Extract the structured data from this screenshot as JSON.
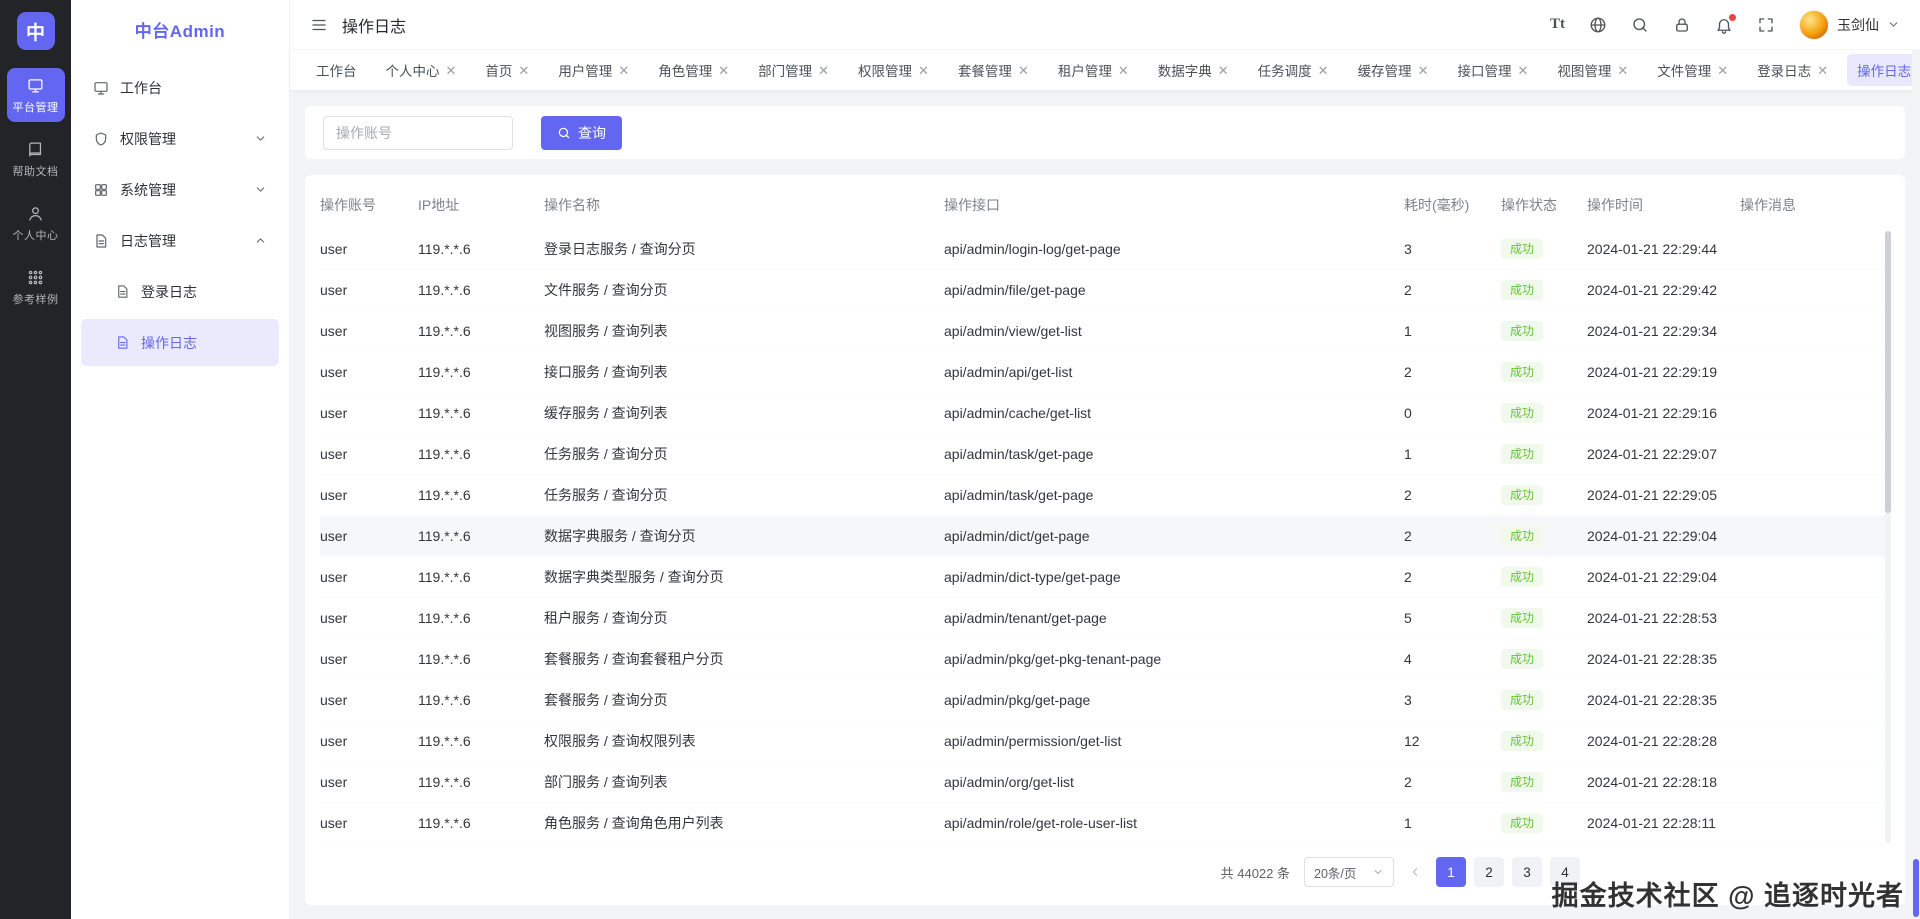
{
  "brand": {
    "logo_text": "中",
    "app_name": "中台Admin"
  },
  "colors": {
    "accent": "#6366f1",
    "success_text": "#67c23a",
    "success_bg": "#f0f9eb",
    "rail_bg": "#232428"
  },
  "rail": {
    "items": [
      {
        "label": "平台管理",
        "icon": "platform",
        "glyph": "monitor",
        "active": true
      },
      {
        "label": "帮助文档",
        "icon": "help-docs",
        "glyph": "book",
        "active": false
      },
      {
        "label": "个人中心",
        "icon": "profile",
        "glyph": "user",
        "active": false
      },
      {
        "label": "参考样例",
        "icon": "samples",
        "glyph": "apps",
        "active": false
      }
    ]
  },
  "sidebar": {
    "title": "中台Admin",
    "items": [
      {
        "label": "工作台",
        "glyph": "monitor",
        "expandable": false
      },
      {
        "label": "权限管理",
        "glyph": "shield",
        "expandable": true,
        "expanded": false
      },
      {
        "label": "系统管理",
        "glyph": "grid",
        "expandable": true,
        "expanded": false
      },
      {
        "label": "日志管理",
        "glyph": "doc",
        "expandable": true,
        "expanded": true,
        "children": [
          {
            "label": "登录日志",
            "active": false
          },
          {
            "label": "操作日志",
            "active": true
          }
        ]
      }
    ]
  },
  "header": {
    "title": "操作日志",
    "user_name": "玉剑仙",
    "actions": [
      "text-size",
      "globe",
      "search",
      "lock",
      "bell",
      "fullscreen"
    ]
  },
  "tabs": [
    {
      "label": "工作台",
      "closable": false,
      "active": false
    },
    {
      "label": "个人中心",
      "closable": true,
      "active": false
    },
    {
      "label": "首页",
      "closable": true,
      "active": false
    },
    {
      "label": "用户管理",
      "closable": true,
      "active": false
    },
    {
      "label": "角色管理",
      "closable": true,
      "active": false
    },
    {
      "label": "部门管理",
      "closable": true,
      "active": false
    },
    {
      "label": "权限管理",
      "closable": true,
      "active": false
    },
    {
      "label": "套餐管理",
      "closable": true,
      "active": false
    },
    {
      "label": "租户管理",
      "closable": true,
      "active": false
    },
    {
      "label": "数据字典",
      "closable": true,
      "active": false
    },
    {
      "label": "任务调度",
      "closable": true,
      "active": false
    },
    {
      "label": "缓存管理",
      "closable": true,
      "active": false
    },
    {
      "label": "接口管理",
      "closable": true,
      "active": false
    },
    {
      "label": "视图管理",
      "closable": true,
      "active": false
    },
    {
      "label": "文件管理",
      "closable": true,
      "active": false
    },
    {
      "label": "登录日志",
      "closable": true,
      "active": false
    },
    {
      "label": "操作日志",
      "closable": true,
      "active": true
    }
  ],
  "search": {
    "placeholder": "操作账号",
    "button_label": "查询"
  },
  "table": {
    "columns": [
      "操作账号",
      "IP地址",
      "操作名称",
      "操作接口",
      "耗时(毫秒)",
      "操作状态",
      "操作时间",
      "操作消息"
    ],
    "rows": [
      {
        "account": "user",
        "ip": "119.*.*.6",
        "name": "登录日志服务 / 查询分页",
        "api": "api/admin/login-log/get-page",
        "ms": "3",
        "status": "成功",
        "time": "2024-01-21 22:29:44",
        "msg": ""
      },
      {
        "account": "user",
        "ip": "119.*.*.6",
        "name": "文件服务 / 查询分页",
        "api": "api/admin/file/get-page",
        "ms": "2",
        "status": "成功",
        "time": "2024-01-21 22:29:42",
        "msg": ""
      },
      {
        "account": "user",
        "ip": "119.*.*.6",
        "name": "视图服务 / 查询列表",
        "api": "api/admin/view/get-list",
        "ms": "1",
        "status": "成功",
        "time": "2024-01-21 22:29:34",
        "msg": ""
      },
      {
        "account": "user",
        "ip": "119.*.*.6",
        "name": "接口服务 / 查询列表",
        "api": "api/admin/api/get-list",
        "ms": "2",
        "status": "成功",
        "time": "2024-01-21 22:29:19",
        "msg": ""
      },
      {
        "account": "user",
        "ip": "119.*.*.6",
        "name": "缓存服务 / 查询列表",
        "api": "api/admin/cache/get-list",
        "ms": "0",
        "status": "成功",
        "time": "2024-01-21 22:29:16",
        "msg": ""
      },
      {
        "account": "user",
        "ip": "119.*.*.6",
        "name": "任务服务 / 查询分页",
        "api": "api/admin/task/get-page",
        "ms": "1",
        "status": "成功",
        "time": "2024-01-21 22:29:07",
        "msg": ""
      },
      {
        "account": "user",
        "ip": "119.*.*.6",
        "name": "任务服务 / 查询分页",
        "api": "api/admin/task/get-page",
        "ms": "2",
        "status": "成功",
        "time": "2024-01-21 22:29:05",
        "msg": ""
      },
      {
        "account": "user",
        "ip": "119.*.*.6",
        "name": "数据字典服务 / 查询分页",
        "api": "api/admin/dict/get-page",
        "ms": "2",
        "status": "成功",
        "time": "2024-01-21 22:29:04",
        "msg": "",
        "highlighted": true
      },
      {
        "account": "user",
        "ip": "119.*.*.6",
        "name": "数据字典类型服务 / 查询分页",
        "api": "api/admin/dict-type/get-page",
        "ms": "2",
        "status": "成功",
        "time": "2024-01-21 22:29:04",
        "msg": ""
      },
      {
        "account": "user",
        "ip": "119.*.*.6",
        "name": "租户服务 / 查询分页",
        "api": "api/admin/tenant/get-page",
        "ms": "5",
        "status": "成功",
        "time": "2024-01-21 22:28:53",
        "msg": ""
      },
      {
        "account": "user",
        "ip": "119.*.*.6",
        "name": "套餐服务 / 查询套餐租户分页",
        "api": "api/admin/pkg/get-pkg-tenant-page",
        "ms": "4",
        "status": "成功",
        "time": "2024-01-21 22:28:35",
        "msg": ""
      },
      {
        "account": "user",
        "ip": "119.*.*.6",
        "name": "套餐服务 / 查询分页",
        "api": "api/admin/pkg/get-page",
        "ms": "3",
        "status": "成功",
        "time": "2024-01-21 22:28:35",
        "msg": ""
      },
      {
        "account": "user",
        "ip": "119.*.*.6",
        "name": "权限服务 / 查询权限列表",
        "api": "api/admin/permission/get-list",
        "ms": "12",
        "status": "成功",
        "time": "2024-01-21 22:28:28",
        "msg": ""
      },
      {
        "account": "user",
        "ip": "119.*.*.6",
        "name": "部门服务 / 查询列表",
        "api": "api/admin/org/get-list",
        "ms": "2",
        "status": "成功",
        "time": "2024-01-21 22:28:18",
        "msg": ""
      },
      {
        "account": "user",
        "ip": "119.*.*.6",
        "name": "角色服务 / 查询角色用户列表",
        "api": "api/admin/role/get-role-user-list",
        "ms": "1",
        "status": "成功",
        "time": "2024-01-21 22:28:11",
        "msg": ""
      }
    ]
  },
  "pagination": {
    "total_text": "共 44022 条",
    "page_size": "20条/页",
    "pages": [
      "1",
      "2",
      "3",
      "4"
    ],
    "active_page": "1"
  },
  "watermark": "掘金技术社区 @ 追逐时光者"
}
